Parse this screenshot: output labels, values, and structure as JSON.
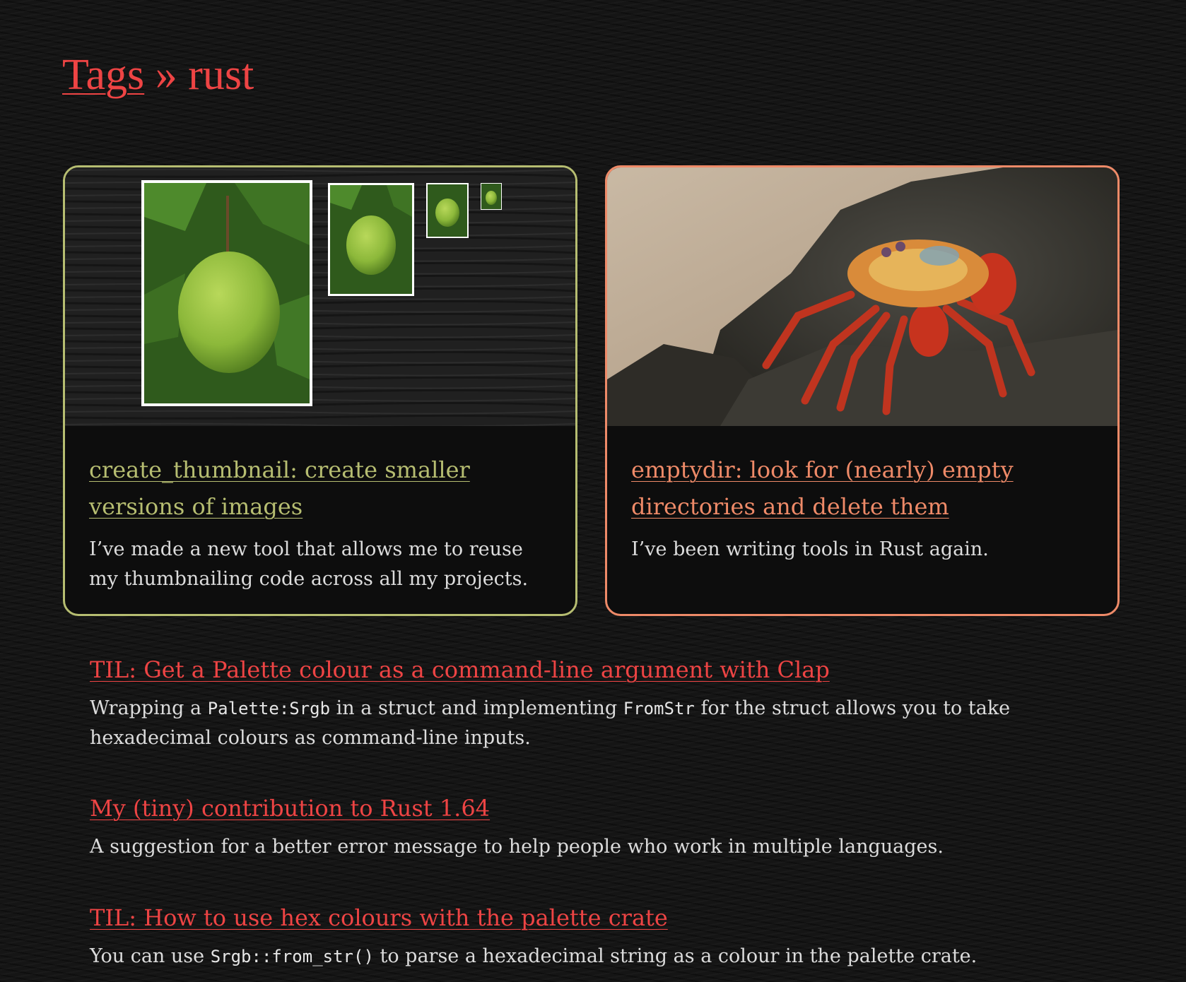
{
  "header": {
    "tags_link": "Tags",
    "separator": " » ",
    "tag_name": "rust"
  },
  "featured": [
    {
      "title": "create_thumbnail: create smaller versions of images",
      "description": "I’ve made a new tool that allows me to reuse my thumbnailing code across all my projects.",
      "accent_color": "#b6bd71",
      "image": "lime-thumbnails-image"
    },
    {
      "title": "emptydir: look for (nearly) empty directories and delete them",
      "description": "I’ve been writing tools in Rust again.",
      "accent_color": "#ee8a68",
      "image": "crab-on-rock-image"
    }
  ],
  "posts": [
    {
      "title": "TIL: Get a Palette colour as a command-line argument with Clap",
      "desc_1": "Wrapping a ",
      "code_1": "Palette:Srgb",
      "desc_2": " in a struct and implementing ",
      "code_2": "FromStr",
      "desc_3": " for the struct allows you to take hexadecimal colours as command-line inputs."
    },
    {
      "title": "My (tiny) contribution to Rust 1.64",
      "desc_1": "A suggestion for a better error message to help people who work in multiple languages."
    },
    {
      "title": "TIL: How to use hex colours with the palette crate",
      "desc_1": "You can use ",
      "code_1": "Srgb::from_str()",
      "desc_2": " to parse a hexadecimal string as a colour in the palette crate."
    }
  ],
  "colors": {
    "link": "#ee4444",
    "text": "#dcdcdc",
    "background": "#151515"
  }
}
